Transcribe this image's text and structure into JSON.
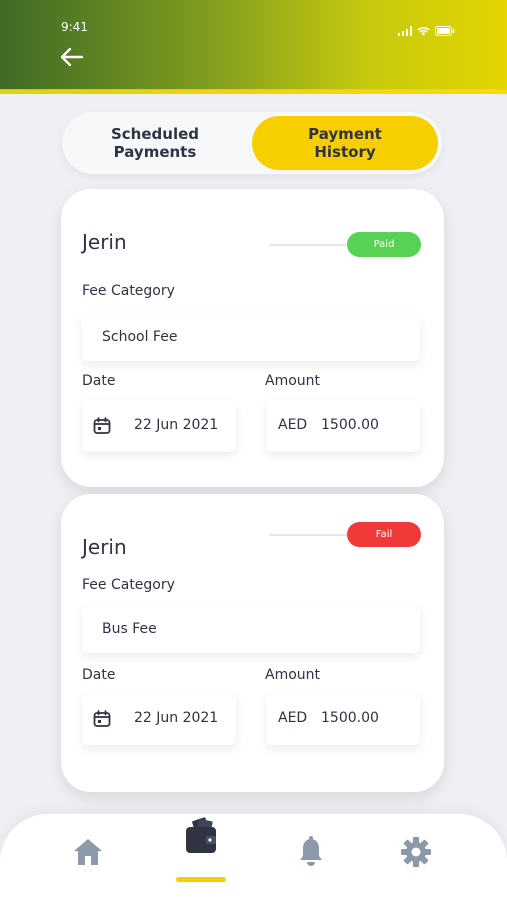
{
  "status_bar": {
    "time": "9:41"
  },
  "tabs": {
    "scheduled": "Scheduled\nPayments",
    "history": "Payment\nHistory"
  },
  "payments": [
    {
      "name": "Jerin",
      "status": "Paid",
      "status_color": "#58d255",
      "fee_category_label": "Fee Category",
      "fee_category": "School Fee",
      "date_label": "Date",
      "date": "22 Jun 2021",
      "amount_label": "Amount",
      "currency": "AED",
      "amount": "1500.00"
    },
    {
      "name": "Jerin",
      "status": "Fail",
      "status_color": "#f03a3a",
      "fee_category_label": "Fee Category",
      "fee_category": "Bus Fee",
      "date_label": "Date",
      "date": "22 Jun 2021",
      "amount_label": "Amount",
      "currency": "AED",
      "amount": "1500.00"
    }
  ],
  "nav": {
    "items": [
      "home-icon",
      "wallet-icon",
      "bell-icon",
      "gear-icon"
    ],
    "active": "wallet-icon"
  },
  "colors": {
    "accent": "#f7cf00",
    "text": "#2f3342",
    "inactive_icon": "#8d99a8"
  }
}
